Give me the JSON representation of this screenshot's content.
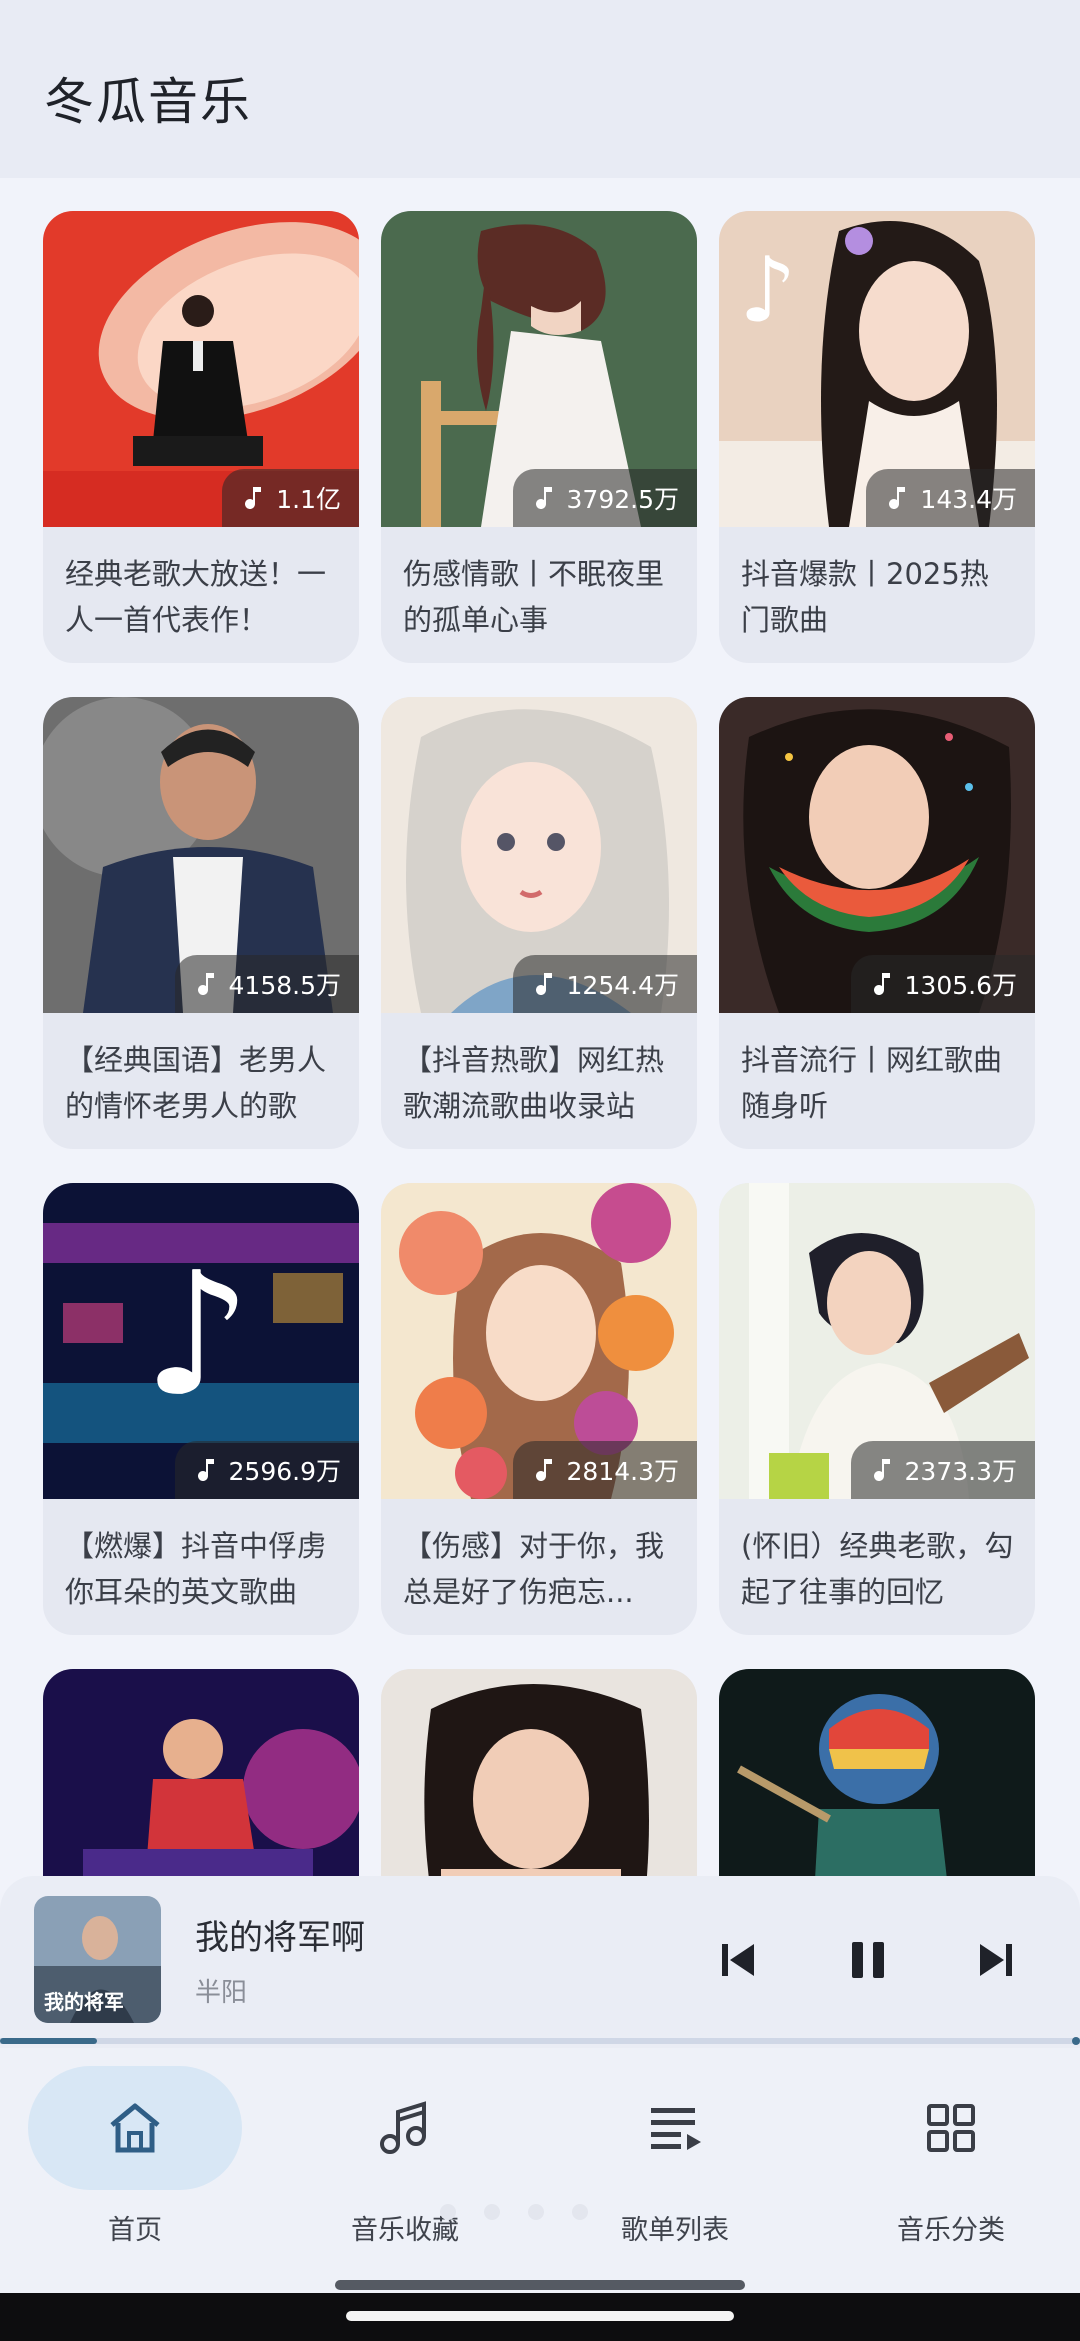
{
  "app": {
    "title": "冬瓜音乐"
  },
  "playlists": [
    {
      "plays": "1.1亿",
      "title": "经典老歌大放送！一人一首代表作！"
    },
    {
      "plays": "3792.5万",
      "title": "伤感情歌丨不眠夜里的孤单心事"
    },
    {
      "plays": "143.4万",
      "title": "抖音爆款丨2025热门歌曲"
    },
    {
      "plays": "4158.5万",
      "title": "【经典国语】老男人的情怀老男人的歌"
    },
    {
      "plays": "1254.4万",
      "title": "【抖音热歌】网红热歌潮流歌曲收录站"
    },
    {
      "plays": "1305.6万",
      "title": "抖音流行丨网红歌曲随身听"
    },
    {
      "plays": "2596.9万",
      "title": "【燃爆】抖音中俘虏你耳朵的英文歌曲"
    },
    {
      "plays": "2814.3万",
      "title": "【伤感】对于你，我总是好了伤疤忘..."
    },
    {
      "plays": "2373.3万",
      "title": "(怀旧）经典老歌，勾起了往事的回忆"
    },
    {
      "plays": "",
      "title": ""
    },
    {
      "plays": "",
      "title": ""
    },
    {
      "plays": "",
      "title": ""
    }
  ],
  "player": {
    "song": "我的将军啊",
    "artist": "半阳",
    "art_caption": "我的将军",
    "progress_fraction": 0.09
  },
  "nav": {
    "home": "首页",
    "favorites": "音乐收藏",
    "playlists": "歌单列表",
    "categories": "音乐分类"
  },
  "colors": {
    "accent": "#2f5e86",
    "active_pill": "#d8e7f5"
  },
  "icons": [
    "music-note-icon",
    "skip-previous-icon",
    "pause-icon",
    "skip-next-icon",
    "home-icon",
    "music-collection-icon",
    "playlist-icon",
    "grid-category-icon"
  ]
}
